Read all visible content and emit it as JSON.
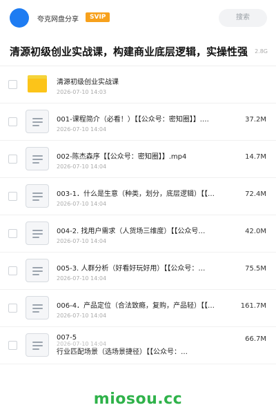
{
  "header": {
    "username": "夸克网盘分享",
    "badge": "SVIP",
    "search_label": "搜索"
  },
  "share": {
    "title": "清源初级创业实战课，构建商业底层逻辑，实操性强",
    "size": "2.8G"
  },
  "files": [
    {
      "name": "清源初级创业实战课",
      "date": "2026-07-10 14:03",
      "size": "",
      "type": "folder"
    },
    {
      "name": "001-课程简介（必看！）【【公众号：密知圈】】.…",
      "date": "2026-07-10 14:04",
      "size": "37.2M",
      "type": "file"
    },
    {
      "name": "002-陈杰森序【【公众号：密知圈】】.mp4",
      "date": "2026-07-10 14:04",
      "size": "14.7M",
      "type": "file"
    },
    {
      "name": "003-1．什么是生意（种类，划分，底层逻辑）【【…",
      "date": "2026-07-10 14:04",
      "size": "72.4M",
      "type": "file"
    },
    {
      "name": "004-2. 找用户需求（人货场三维度）【【公众号…",
      "date": "2026-07-10 14:04",
      "size": "42.0M",
      "type": "file"
    },
    {
      "name": "005-3. 人群分析（好看好玩好用）【【公众号：…",
      "date": "2026-07-10 14:04",
      "size": "75.5M",
      "type": "file"
    },
    {
      "name": "006-4．产品定位（合法致瘾，复购，产品轻）【【…",
      "date": "2026-07-10 14:04",
      "size": "161.7M",
      "type": "file"
    }
  ],
  "last_file": {
    "name_line1": "007-5",
    "name_line2": "行业匹配场景（选场景捷径）【【公众号：…",
    "date": "2026-07-10 14:04",
    "size": "66.7M"
  },
  "watermark": "miosou.cc",
  "colors": {
    "accent": "#1e7cf2",
    "svip": "#f7a11c",
    "folder": "#fcc419",
    "watermark": "#2fb24a"
  }
}
